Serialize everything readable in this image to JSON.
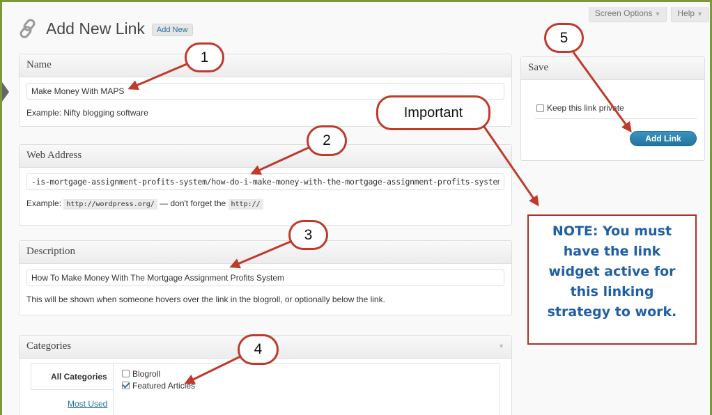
{
  "screen_meta": {
    "screen_options": "Screen Options",
    "help": "Help"
  },
  "page": {
    "title": "Add New Link",
    "add_new": "Add New"
  },
  "name_box": {
    "heading": "Name",
    "value": "Make Money With MAPS",
    "hint": "Example: Nifty blogging software"
  },
  "web_box": {
    "heading": "Web Address",
    "value": "-is-mortgage-assignment-profits-system/how-do-i-make-money-with-the-mortgage-assignment-profits-system/",
    "hint_prefix": "Example:",
    "hint_code1": "http://wordpress.org/",
    "hint_mid": "— don't forget the",
    "hint_code2": "http://"
  },
  "desc_box": {
    "heading": "Description",
    "value": "How To Make Money With The Mortgage Assignment Profits System",
    "hint": "This will be shown when someone hovers over the link in the blogroll, or optionally below the link."
  },
  "cat_box": {
    "heading": "Categories",
    "tab_all": "All Categories",
    "tab_most": "Most Used",
    "items": [
      {
        "label": "Blogroll",
        "checked": false
      },
      {
        "label": "Featured Articles",
        "checked": true
      }
    ]
  },
  "save_box": {
    "heading": "Save",
    "private_label": "Keep this link private",
    "add_button": "Add Link"
  },
  "callouts": {
    "c1": "1",
    "c2": "2",
    "c3": "3",
    "c4": "4",
    "c5": "5",
    "important": "Important"
  },
  "note": {
    "line1": "NOTE:  You must",
    "line2": "have the link",
    "line3": "widget active for",
    "line4": "this linking",
    "line5": "strategy to work."
  },
  "colors": {
    "annotation_red": "#c0392b",
    "note_blue": "#1f5fa5",
    "wp_blue": "#21759b",
    "frame_green": "#7a9a3a"
  },
  "icons": {
    "title_icon": "link-chain-icon"
  }
}
